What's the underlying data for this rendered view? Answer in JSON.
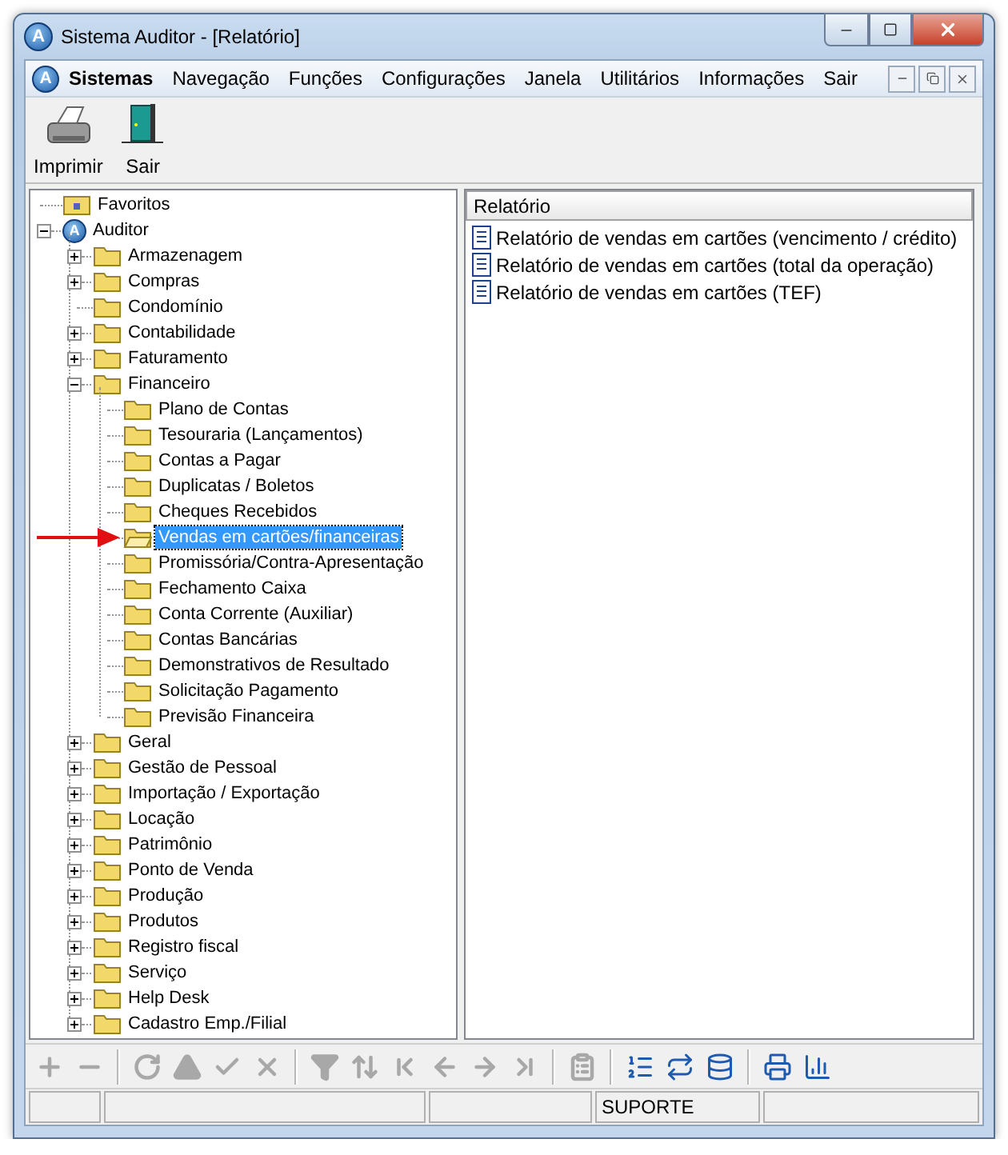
{
  "window": {
    "title": "Sistema Auditor - [Relatório]",
    "icon_text": "A"
  },
  "menu": {
    "icon_text": "A",
    "items": [
      {
        "label": "Sistemas",
        "emphasized": true
      },
      {
        "label": "Navegação",
        "emphasized": false
      },
      {
        "label": "Funções",
        "emphasized": false
      },
      {
        "label": "Configurações",
        "emphasized": false
      },
      {
        "label": "Janela",
        "emphasized": false
      },
      {
        "label": "Utilitários",
        "emphasized": false
      },
      {
        "label": "Informações",
        "emphasized": false
      },
      {
        "label": "Sair",
        "emphasized": false
      }
    ]
  },
  "toolbar": [
    {
      "kind": "print",
      "label": "Imprimir"
    },
    {
      "kind": "exit",
      "label": "Sair"
    }
  ],
  "tree": [
    {
      "kind": "favorites",
      "label": "Favoritos",
      "selected": false
    },
    {
      "kind": "root",
      "label": "Auditor",
      "icon_text": "A",
      "selected": false,
      "expanded": true,
      "children": [
        {
          "kind": "folder",
          "label": "Armazenagem",
          "selected": false,
          "expanded": false
        },
        {
          "kind": "folder",
          "label": "Compras",
          "selected": false,
          "expanded": false
        },
        {
          "kind": "folder",
          "label": "Condomínio",
          "selected": false
        },
        {
          "kind": "folder",
          "label": "Contabilidade",
          "selected": false,
          "expanded": false
        },
        {
          "kind": "folder",
          "label": "Faturamento",
          "selected": false,
          "expanded": false
        },
        {
          "kind": "folder",
          "label": "Financeiro",
          "selected": false,
          "expanded": true,
          "children": [
            {
              "kind": "folder",
              "label": "Plano de Contas",
              "selected": false
            },
            {
              "kind": "folder",
              "label": "Tesouraria (Lançamentos)",
              "selected": false
            },
            {
              "kind": "folder",
              "label": "Contas a Pagar",
              "selected": false
            },
            {
              "kind": "folder",
              "label": "Duplicatas / Boletos",
              "selected": false
            },
            {
              "kind": "folder",
              "label": "Cheques Recebidos",
              "selected": false
            },
            {
              "kind": "folder",
              "label": "Vendas em cartões/financeiras",
              "selected": true
            },
            {
              "kind": "folder",
              "label": "Promissória/Contra-Apresentação",
              "selected": false
            },
            {
              "kind": "folder",
              "label": "Fechamento Caixa",
              "selected": false
            },
            {
              "kind": "folder",
              "label": "Conta Corrente (Auxiliar)",
              "selected": false
            },
            {
              "kind": "folder",
              "label": "Contas Bancárias",
              "selected": false
            },
            {
              "kind": "folder",
              "label": "Demonstrativos de Resultado",
              "selected": false
            },
            {
              "kind": "folder",
              "label": "Solicitação Pagamento",
              "selected": false
            },
            {
              "kind": "folder",
              "label": "Previsão Financeira",
              "selected": false
            }
          ]
        },
        {
          "kind": "folder",
          "label": "Geral",
          "selected": false,
          "expanded": false
        },
        {
          "kind": "folder",
          "label": "Gestão de Pessoal",
          "selected": false,
          "expanded": false
        },
        {
          "kind": "folder",
          "label": "Importação / Exportação",
          "selected": false,
          "expanded": false
        },
        {
          "kind": "folder",
          "label": "Locação",
          "selected": false,
          "expanded": false
        },
        {
          "kind": "folder",
          "label": "Patrimônio",
          "selected": false,
          "expanded": false
        },
        {
          "kind": "folder",
          "label": "Ponto de Venda",
          "selected": false,
          "expanded": false
        },
        {
          "kind": "folder",
          "label": "Produção",
          "selected": false,
          "expanded": false
        },
        {
          "kind": "folder",
          "label": "Produtos",
          "selected": false,
          "expanded": false
        },
        {
          "kind": "folder",
          "label": "Registro fiscal",
          "selected": false,
          "expanded": false
        },
        {
          "kind": "folder",
          "label": "Serviço",
          "selected": false,
          "expanded": false
        },
        {
          "kind": "folder",
          "label": "Help Desk",
          "selected": false,
          "expanded": false
        },
        {
          "kind": "folder",
          "label": "Cadastro Emp./Filial",
          "selected": false,
          "expanded": false
        }
      ]
    }
  ],
  "report_list": {
    "column": "Relatório",
    "items": [
      "Relatório de vendas em cartões (vencimento / crédito)",
      "Relatório de vendas em cartões (total da operação)",
      "Relatório de vendas em cartões (TEF)"
    ]
  },
  "bottom_toolbar": [
    {
      "kind": "add",
      "disabled": true
    },
    {
      "kind": "remove",
      "disabled": true
    },
    {
      "kind": "separator"
    },
    {
      "kind": "refresh",
      "disabled": true
    },
    {
      "kind": "up",
      "disabled": true
    },
    {
      "kind": "confirm",
      "disabled": true
    },
    {
      "kind": "cancel",
      "disabled": true
    },
    {
      "kind": "separator"
    },
    {
      "kind": "filter",
      "disabled": true
    },
    {
      "kind": "sort",
      "disabled": true
    },
    {
      "kind": "first",
      "disabled": true
    },
    {
      "kind": "previous",
      "disabled": true
    },
    {
      "kind": "next",
      "disabled": true
    },
    {
      "kind": "last",
      "disabled": true
    },
    {
      "kind": "separator"
    },
    {
      "kind": "copy",
      "disabled": true
    },
    {
      "kind": "separator"
    },
    {
      "kind": "export",
      "disabled": false
    },
    {
      "kind": "transfer",
      "disabled": false
    },
    {
      "kind": "list",
      "disabled": false
    },
    {
      "kind": "separator"
    },
    {
      "kind": "print",
      "disabled": false
    },
    {
      "kind": "chart",
      "disabled": false
    }
  ],
  "status_bar": {
    "user": "SUPORTE"
  }
}
